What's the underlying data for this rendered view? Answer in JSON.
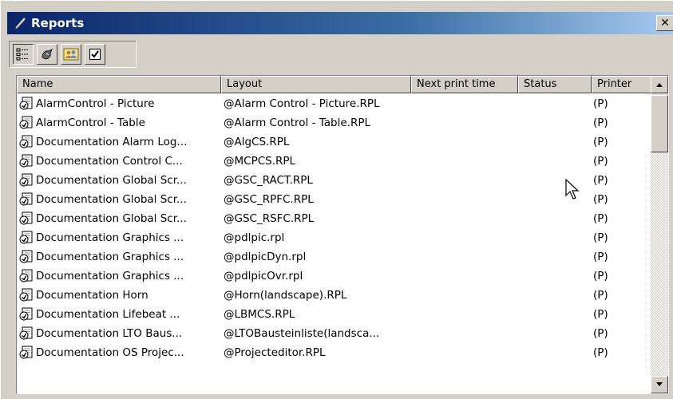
{
  "window": {
    "title": "Reports",
    "close_label": "✕",
    "icon": "quill-report-icon"
  },
  "toolbar": {
    "buttons": [
      {
        "icon": "list-view-icon",
        "pressed": true
      },
      {
        "icon": "lightning-printer-icon",
        "pressed": false
      },
      {
        "icon": "users-icon",
        "pressed": false
      },
      {
        "icon": "checkbox-icon",
        "pressed": false
      }
    ]
  },
  "columns": {
    "name": "Name",
    "layout": "Layout",
    "next_print_time": "Next print time",
    "status": "Status",
    "printer": "Printer"
  },
  "rows": [
    {
      "name": "AlarmControl - Picture",
      "layout": "@Alarm Control - Picture.RPL",
      "next": "",
      "status": "",
      "printer": "(P)"
    },
    {
      "name": "AlarmControl - Table",
      "layout": "@Alarm Control - Table.RPL",
      "next": "",
      "status": "",
      "printer": "(P)"
    },
    {
      "name": "Documentation Alarm Log...",
      "layout": "@AlgCS.RPL",
      "next": "",
      "status": "",
      "printer": "(P)"
    },
    {
      "name": "Documentation Control C...",
      "layout": "@MCPCS.RPL",
      "next": "",
      "status": "",
      "printer": "(P)"
    },
    {
      "name": "Documentation Global Scr...",
      "layout": "@GSC_RACT.RPL",
      "next": "",
      "status": "",
      "printer": "(P)"
    },
    {
      "name": "Documentation Global Scr...",
      "layout": "@GSC_RPFC.RPL",
      "next": "",
      "status": "",
      "printer": "(P)"
    },
    {
      "name": "Documentation Global Scr...",
      "layout": "@GSC_RSFC.RPL",
      "next": "",
      "status": "",
      "printer": "(P)"
    },
    {
      "name": "Documentation Graphics ...",
      "layout": "@pdlpic.rpl",
      "next": "",
      "status": "",
      "printer": "(P)"
    },
    {
      "name": "Documentation Graphics ...",
      "layout": "@pdlpicDyn.rpl",
      "next": "",
      "status": "",
      "printer": "(P)"
    },
    {
      "name": "Documentation Graphics ...",
      "layout": "@pdlpicOvr.rpl",
      "next": "",
      "status": "",
      "printer": "(P)"
    },
    {
      "name": "Documentation Horn",
      "layout": "@Horn(landscape).RPL",
      "next": "",
      "status": "",
      "printer": "(P)"
    },
    {
      "name": "Documentation Lifebeat ...",
      "layout": "@LBMCS.RPL",
      "next": "",
      "status": "",
      "printer": "(P)"
    },
    {
      "name": "Documentation LTO Baus...",
      "layout": "@LTOBausteinliste(landsca...",
      "next": "",
      "status": "",
      "printer": "(P)"
    },
    {
      "name": "Documentation OS Projec...",
      "layout": "@Projecteditor.RPL",
      "next": "",
      "status": "",
      "printer": "(P)"
    }
  ]
}
